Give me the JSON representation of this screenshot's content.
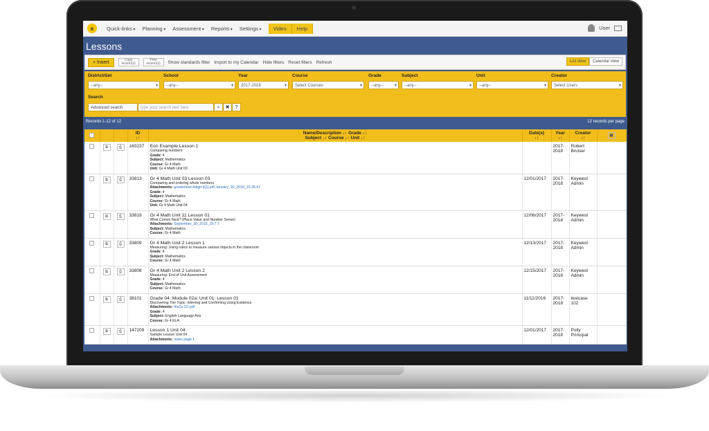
{
  "nav": {
    "logo": "e",
    "menus": [
      "Quick-links",
      "Planning",
      "Assessment",
      "Reports",
      "Settings"
    ],
    "highlight": [
      "Video",
      "Help"
    ],
    "user": "User"
  },
  "page": {
    "title": "Lessons"
  },
  "toolbar": {
    "insert": "+ Insert",
    "copy": "Copy lesson(s)",
    "print": "Print lesson(s)",
    "show_standards": "Show standards filter",
    "import": "Import to my Calendar",
    "hide_filters": "Hide filters",
    "reset_filters": "Reset filters",
    "refresh": "Refresh",
    "list_view": "List view",
    "calendar_view": "Calendar view"
  },
  "filters": {
    "district": {
      "label": "District/Set",
      "value": "--any--"
    },
    "school": {
      "label": "School",
      "value": "--any--"
    },
    "year": {
      "label": "Year",
      "value": "2017-2018"
    },
    "course": {
      "label": "Course",
      "value": "Select Courses"
    },
    "grade": {
      "label": "Grade",
      "value": "--any--"
    },
    "subject": {
      "label": "Subject",
      "value": "--any--"
    },
    "unit": {
      "label": "Unit",
      "value": "--any--"
    },
    "creator": {
      "label": "Creator",
      "value": "Select Users"
    },
    "search": {
      "label": "Search",
      "mode": "Advanced search",
      "placeholder": "type your search text here",
      "q": "⌕",
      "x": "✖",
      "help": "?"
    }
  },
  "records": {
    "summary": "Records 1-12 of 12",
    "per_page": "12  records per page"
  },
  "table": {
    "headers": {
      "id": "ID",
      "name": "Name/Description ↓↑ Grade ↓↑",
      "name2": "Subject ↓↑ Course ↓↑ Unit ↓↑",
      "date": "Date(s)",
      "year": "Year",
      "creator": "Creator",
      "sort": "↓↑"
    },
    "rows": [
      {
        "id": "160237",
        "name": "Eon Example Lesson 1",
        "desc": "Comparing numbers",
        "attach": "",
        "grade": "4",
        "subject": "Mathematics",
        "course": "Gr 4 Math",
        "unit": "Gr 4 Math Unit 03",
        "date": "",
        "year": "2017-2018",
        "creator": "Robert Bruiser"
      },
      {
        "id": "33813",
        "name": "Gr 4 Math Unit 03 Lesson 03",
        "desc": "Comparing and ordering whole numbers",
        "attach": "greaterless-6digit-b[1].pdf  January_30_2018_15:26:47",
        "grade": "4",
        "subject": "Mathematics",
        "course": "Gr 4 Math",
        "unit": "Gr 4 Math Unit 04",
        "date": "12/01/2017",
        "year": "2017-2018",
        "creator": "Keywest Admin"
      },
      {
        "id": "33819",
        "name": "Gr 4 Math Unit 11 Lesson 01",
        "desc": "What Comes Next? (Place Value and Number Sense)",
        "attach": "September_30_2015_15:7:7",
        "grade": "",
        "subject": "Mathematics",
        "course": "Gr 4 Math",
        "unit": "",
        "date": "12/06/2017",
        "year": "2017-2018",
        "creator": "Keywest Admin"
      },
      {
        "id": "33809",
        "name": "Gr 4 Math Unit 2 Lesson 1",
        "desc": "Measuring: Using rulers to measure various objects in the classroom",
        "attach": "",
        "grade": "4",
        "subject": "Mathematics",
        "course": "Gr 4 Math",
        "unit": "",
        "date": "12/13/2017",
        "year": "2017-2018",
        "creator": "Keywest Admin"
      },
      {
        "id": "33808",
        "name": "Gr 4 Math Unit 2 Lesson 2",
        "desc": "Measuring: End of Unit Assessment",
        "attach": "",
        "grade": "4",
        "subject": "Mathematics",
        "course": "Gr 4 Math",
        "unit": "",
        "date": "12/15/2017",
        "year": "2017-2018",
        "creator": "Keywest Admin"
      },
      {
        "id": "38101",
        "name": "Grade 04: Module 02a: Unit 01: Lesson 01",
        "desc": "Discovering The Topic: Inferring and Confirming Using Evidence",
        "attach": "4m2a.1l1.pdf",
        "grade": "4",
        "subject": "English Language Arts",
        "course": "Gr 4 ELA",
        "unit": "",
        "date": "11/11/2016",
        "year": "2017-2018",
        "creator": "testcase 102"
      },
      {
        "id": "147209",
        "name": "Lesson 1 Unit 04",
        "desc": "Sample Lesson Unit 04",
        "attach": "notes page 1",
        "grade": "",
        "subject": "",
        "course": "",
        "unit": "",
        "date": "12/01/2017",
        "year": "2017-2018",
        "creator": "Polly Principal"
      }
    ]
  },
  "labels": {
    "attachments": "Attachments:",
    "grade": "Grade:",
    "subject": "Subject:",
    "course": "Course:",
    "unit": "Unit:"
  }
}
